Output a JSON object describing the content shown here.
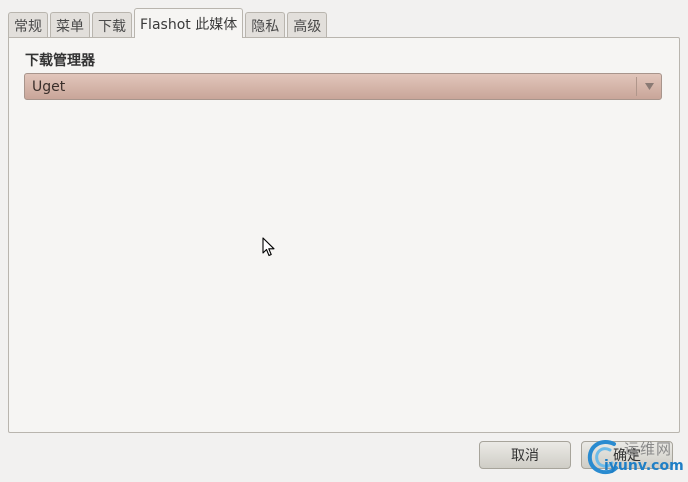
{
  "tabs": [
    {
      "label": "常规"
    },
    {
      "label": "菜单"
    },
    {
      "label": "下载"
    },
    {
      "label": "Flashot 此媒体",
      "active": true
    },
    {
      "label": "隐私"
    },
    {
      "label": "高级"
    }
  ],
  "panel": {
    "section_label": "下载管理器",
    "combo": {
      "selected": "Uget"
    }
  },
  "buttons": {
    "cancel_label": "取消",
    "ok_label": "确定"
  },
  "watermark": {
    "site_cn": "运维网",
    "site_url": "iyunv.com"
  },
  "colors": {
    "combo_fill": "#d4b2a6",
    "panel_bg": "#f6f5f3",
    "window_bg": "#f2f1f0",
    "watermark_accent": "#1f7fc6"
  },
  "icons": {
    "combo_arrow": "chevron-down-icon",
    "cursor": "mouse-pointer-icon",
    "watermark_logo": "swirl-logo-icon"
  }
}
